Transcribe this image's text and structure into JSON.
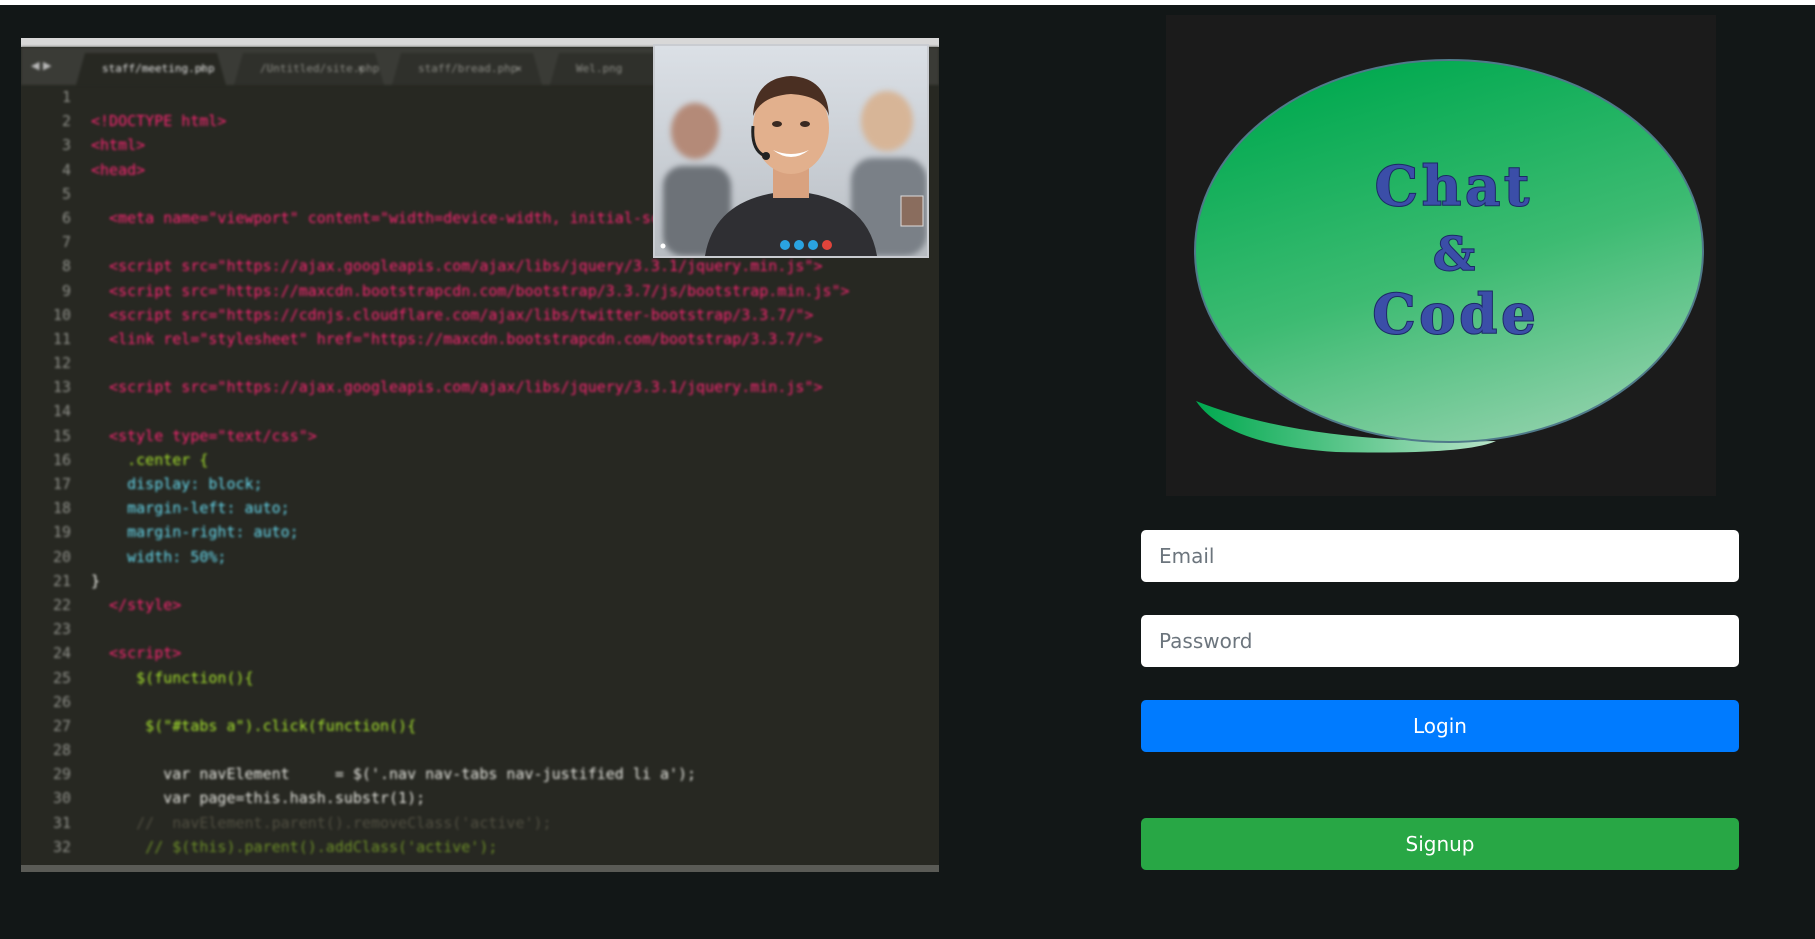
{
  "hero": {
    "tabs": [
      {
        "label": "staff/meeting.php",
        "active": true
      },
      {
        "label": "/Untitled/site.php",
        "active": false
      },
      {
        "label": "staff/bread.php",
        "active": false
      },
      {
        "label": "Wel.png",
        "active": false
      }
    ],
    "code_lines": [
      {
        "n": "1",
        "t": ""
      },
      {
        "n": "2",
        "t": "<!DOCTYPE html>"
      },
      {
        "n": "3",
        "t": "<html>"
      },
      {
        "n": "4",
        "t": "<head>"
      },
      {
        "n": "5",
        "t": ""
      },
      {
        "n": "6",
        "t": "  <meta name=\"viewport\" content=\"width=device-width, initial-scale=1\">"
      },
      {
        "n": "7",
        "t": ""
      },
      {
        "n": "8",
        "t": "  <script src=\"https://ajax.googleapis.com/ajax/libs/jquery/3.3.1/jquery.min.js\">"
      },
      {
        "n": "9",
        "t": "  <script src=\"https://maxcdn.bootstrapcdn.com/bootstrap/3.3.7/js/bootstrap.min.js\">"
      },
      {
        "n": "10",
        "t": "  <script src=\"https://cdnjs.cloudflare.com/ajax/libs/twitter-bootstrap/3.3.7/\">"
      },
      {
        "n": "11",
        "t": "  <link rel=\"stylesheet\" href=\"https://maxcdn.bootstrapcdn.com/bootstrap/3.3.7/\">"
      },
      {
        "n": "12",
        "t": ""
      },
      {
        "n": "13",
        "t": "  <script src=\"https://ajax.googleapis.com/ajax/libs/jquery/3.3.1/jquery.min.js\">"
      },
      {
        "n": "14",
        "t": ""
      },
      {
        "n": "15",
        "t": "  <style type=\"text/css\">"
      },
      {
        "n": "16",
        "t": "    .center {"
      },
      {
        "n": "17",
        "t": "    display: block;"
      },
      {
        "n": "18",
        "t": "    margin-left: auto;"
      },
      {
        "n": "19",
        "t": "    margin-right: auto;"
      },
      {
        "n": "20",
        "t": "    width: 50%;"
      },
      {
        "n": "21",
        "t": "}"
      },
      {
        "n": "22",
        "t": "  </style>"
      },
      {
        "n": "23",
        "t": ""
      },
      {
        "n": "24",
        "t": "  <script>"
      },
      {
        "n": "25",
        "t": "     $(function(){"
      },
      {
        "n": "26",
        "t": ""
      },
      {
        "n": "27",
        "t": "      $(\"#tabs a\").click(function(){"
      },
      {
        "n": "28",
        "t": ""
      },
      {
        "n": "29",
        "t": "        var navElement     = $('.nav nav-tabs nav-justified li a');"
      },
      {
        "n": "30",
        "t": "        var page=this.hash.substr(1);"
      },
      {
        "n": "31",
        "t": "     //  navElement.parent().removeClass('active');"
      },
      {
        "n": "32",
        "t": "      // $(this).parent().addClass('active');"
      }
    ]
  },
  "logo": {
    "line1": "Chat",
    "line2": "&",
    "line3": "Code"
  },
  "form": {
    "email_placeholder": "Email",
    "password_placeholder": "Password",
    "login_label": "Login",
    "signup_label": "Signup"
  },
  "colors": {
    "background": "#121717",
    "login_button": "#007bff",
    "signup_button": "#28a745",
    "logo_green": "#00aa55",
    "logo_text": "#2a3a8c"
  }
}
